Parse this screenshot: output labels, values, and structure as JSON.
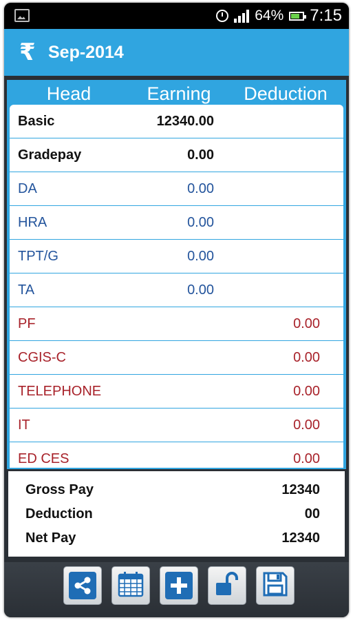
{
  "status_bar": {
    "battery_percent": "64%",
    "time": "7:15"
  },
  "action_bar": {
    "currency_symbol": "₹",
    "title": "Sep-2014"
  },
  "table": {
    "headers": {
      "head": "Head",
      "earning": "Earning",
      "deduction": "Deduction"
    },
    "rows": [
      {
        "head": "Basic",
        "earning": "12340.00",
        "deduction": "",
        "style": "bold"
      },
      {
        "head": "Gradepay",
        "earning": "0.00",
        "deduction": "",
        "style": "bold"
      },
      {
        "head": "DA",
        "earning": "0.00",
        "deduction": "",
        "style": "blue"
      },
      {
        "head": "HRA",
        "earning": "0.00",
        "deduction": "",
        "style": "blue"
      },
      {
        "head": "TPT/G",
        "earning": "0.00",
        "deduction": "",
        "style": "blue"
      },
      {
        "head": "TA",
        "earning": "0.00",
        "deduction": "",
        "style": "blue"
      },
      {
        "head": "PF",
        "earning": "",
        "deduction": "0.00",
        "style": "red"
      },
      {
        "head": "CGIS-C",
        "earning": "",
        "deduction": "0.00",
        "style": "red"
      },
      {
        "head": "TELEPHONE",
        "earning": "",
        "deduction": "0.00",
        "style": "red"
      },
      {
        "head": "IT",
        "earning": "",
        "deduction": "0.00",
        "style": "red"
      },
      {
        "head": "ED CES",
        "earning": "",
        "deduction": "0.00",
        "style": "red"
      }
    ]
  },
  "summary": {
    "gross_pay_label": "Gross Pay",
    "gross_pay_value": "12340",
    "deduction_label": "Deduction",
    "deduction_value": "00",
    "net_pay_label": "Net Pay",
    "net_pay_value": "12340"
  },
  "colors": {
    "accent": "#30a5e0",
    "earning_text": "#23549c",
    "deduction_text": "#a8222a",
    "icon_blue": "#1f6db5"
  },
  "toolbar": {
    "buttons": [
      "share-icon",
      "calendar-icon",
      "add-icon",
      "unlock-icon",
      "save-icon"
    ]
  }
}
